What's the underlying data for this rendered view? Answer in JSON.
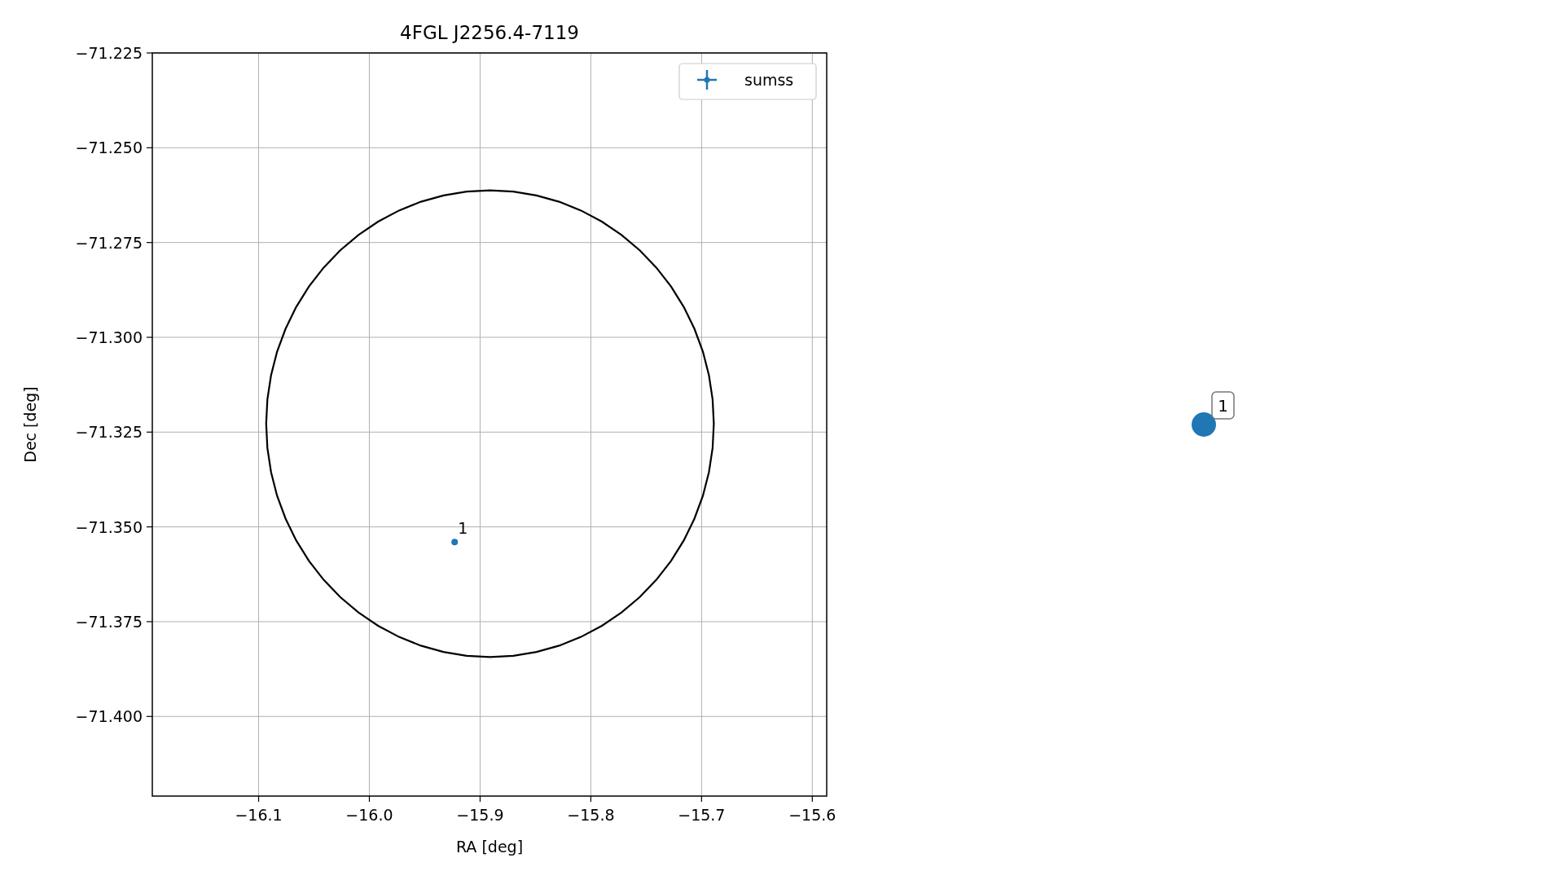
{
  "figure": {
    "chart_data": {
      "type": "scatter",
      "title": "4FGL J2256.4-7119",
      "xlabel": "RA [deg]",
      "ylabel": "Dec [deg]",
      "xlim": [
        -16.196,
        -15.587
      ],
      "ylim": [
        -71.421,
        -71.225
      ],
      "grid": true,
      "xticks": [
        {
          "value": -16.1,
          "label": "−16.1"
        },
        {
          "value": -16.0,
          "label": "−16.0"
        },
        {
          "value": -15.9,
          "label": "−15.9"
        },
        {
          "value": -15.8,
          "label": "−15.8"
        },
        {
          "value": -15.7,
          "label": "−15.7"
        },
        {
          "value": -15.6,
          "label": "−15.6"
        }
      ],
      "yticks": [
        {
          "value": -71.225,
          "label": "−71.225"
        },
        {
          "value": -71.25,
          "label": "−71.250"
        },
        {
          "value": -71.275,
          "label": "−71.275"
        },
        {
          "value": -71.3,
          "label": "−71.300"
        },
        {
          "value": -71.325,
          "label": "−71.325"
        },
        {
          "value": -71.35,
          "label": "−71.350"
        },
        {
          "value": -71.375,
          "label": "−71.375"
        },
        {
          "value": -71.4,
          "label": "−71.400"
        }
      ],
      "series": [
        {
          "name": "sumss",
          "color": "#1f77b4",
          "x": [
            -15.923
          ],
          "values": [
            -71.354
          ]
        }
      ],
      "annotations": [
        {
          "text": "1"
        }
      ]
    },
    "outside_marker": {
      "label": "1",
      "color": "#1f77b4"
    }
  }
}
